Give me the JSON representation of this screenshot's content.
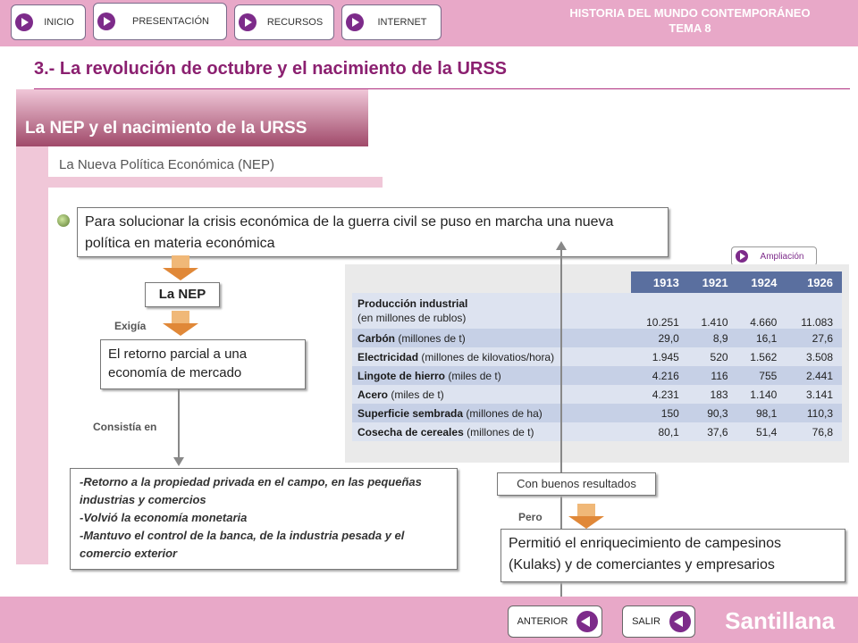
{
  "nav": {
    "inicio": "INICIO",
    "presentacion": "PRESENTACIÓN",
    "recursos": "RECURSOS",
    "internet": "INTERNET"
  },
  "header": {
    "line1": "HISTORIA DEL MUNDO CONTEMPORÁNEO",
    "line2": "TEMA 8"
  },
  "main_title": "3.- La revolución de octubre y el nacimiento de la URSS",
  "section_title": "La NEP y el nacimiento de la URSS",
  "subtitle": "La Nueva Política Económica (NEP)",
  "intro": "Para solucionar la crisis económica de la guerra civil se puso en marcha una nueva política en materia económica",
  "nep_label": "La NEP",
  "exigia": "Exigía",
  "retorno": "El retorno parcial a una economía de mercado",
  "consistia": "Consistía en",
  "list": {
    "line1": "-Retorno a la propiedad privada en el campo, en las pequeñas industrias y comercios",
    "line2": "-Volvió la economía monetaria",
    "line3": "-Mantuvo el control de la banca, de la industria pesada y el comercio exterior"
  },
  "ampliacion": "Ampliación",
  "table": {
    "years": [
      "1913",
      "1921",
      "1924",
      "1926"
    ],
    "rows": [
      {
        "label": "Producción industrial",
        "unit": "(en millones de rublos)",
        "values": [
          "10.251",
          "1.410",
          "4.660",
          "11.083"
        ]
      },
      {
        "label": "Carbón",
        "unit": "(millones de t)",
        "values": [
          "29,0",
          "8,9",
          "16,1",
          "27,6"
        ]
      },
      {
        "label": "Electricidad",
        "unit": "(millones de kilovatios/hora)",
        "values": [
          "1.945",
          "520",
          "1.562",
          "3.508"
        ]
      },
      {
        "label": "Lingote de hierro",
        "unit": "(miles de t)",
        "values": [
          "4.216",
          "116",
          "755",
          "2.441"
        ]
      },
      {
        "label": "Acero",
        "unit": "(miles de t)",
        "values": [
          "4.231",
          "183",
          "1.140",
          "3.141"
        ]
      },
      {
        "label": "Superficie sembrada",
        "unit": "(millones de ha)",
        "values": [
          "150",
          "90,3",
          "98,1",
          "110,3"
        ]
      },
      {
        "label": "Cosecha de cereales",
        "unit": "(millones de t)",
        "values": [
          "80,1",
          "37,6",
          "51,4",
          "76,8"
        ]
      }
    ]
  },
  "resultados": "Con buenos resultados",
  "pero": "Pero",
  "permitio": "Permitió el enriquecimiento de campesinos (Kulaks) y de comerciantes y empresarios",
  "footer": {
    "anterior": "ANTERIOR",
    "salir": "SALIR",
    "brand": "Santillana"
  }
}
